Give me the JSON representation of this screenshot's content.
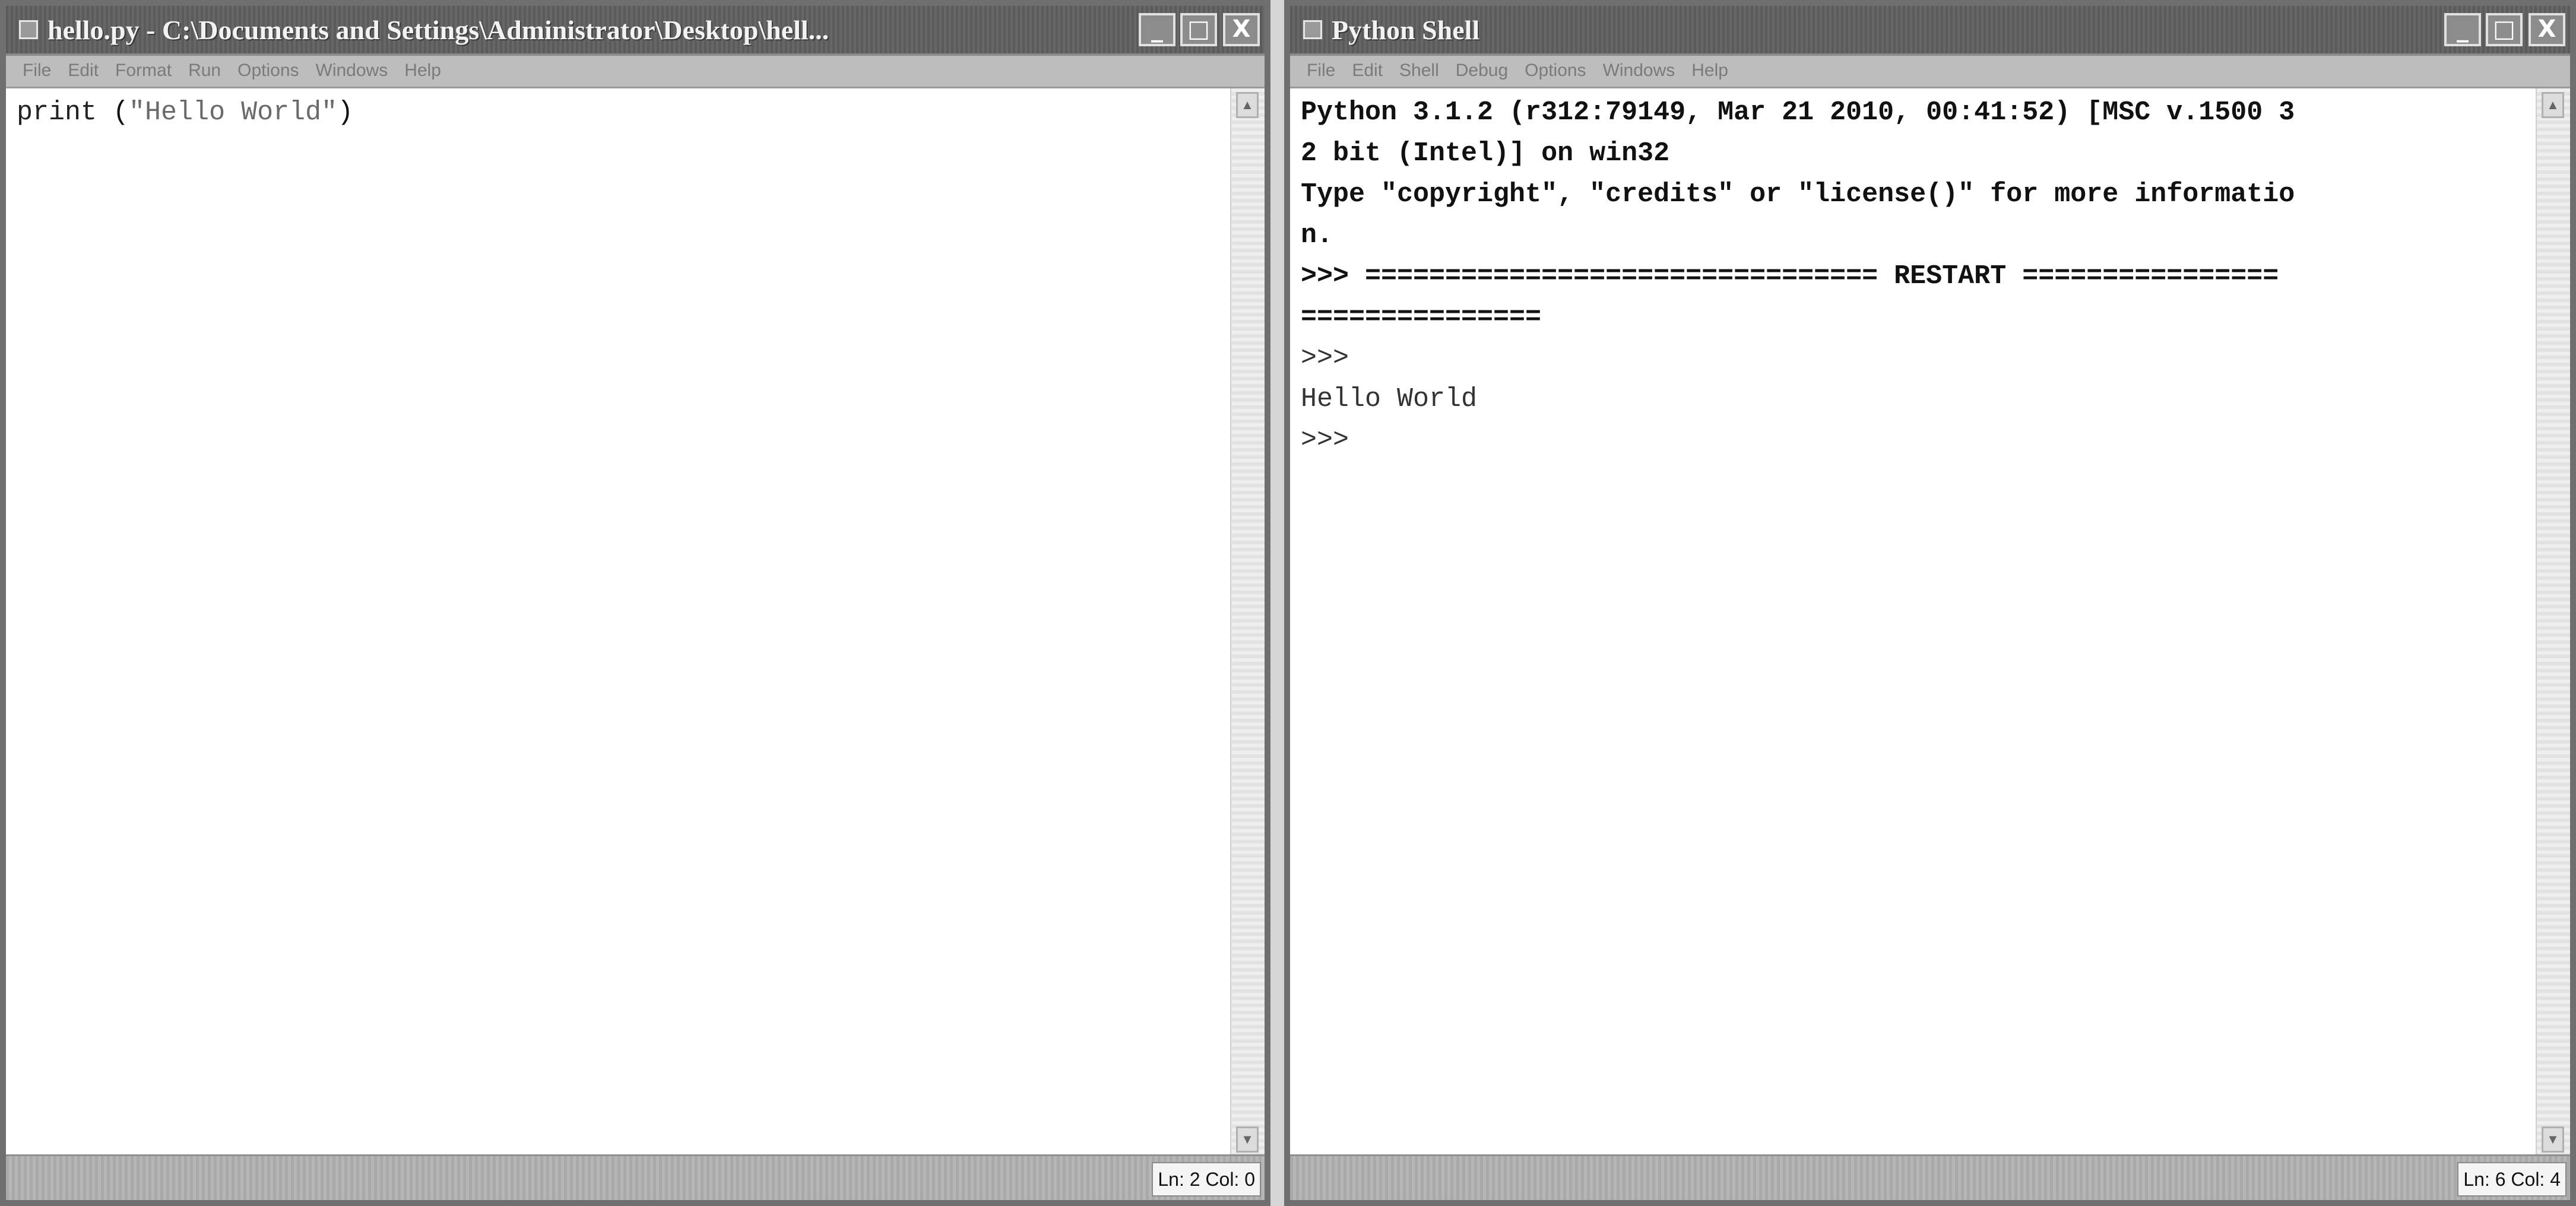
{
  "editor_window": {
    "title": "hello.py - C:\\Documents and Settings\\Administrator\\Desktop\\hell...",
    "menu": [
      "File",
      "Edit",
      "Format",
      "Run",
      "Options",
      "Windows",
      "Help"
    ],
    "code": {
      "func": "print",
      "open": " (",
      "string": "\"Hello World\"",
      "close": ")"
    },
    "status": "Ln: 2 Col: 0",
    "controls": {
      "minimize": "_",
      "maximize": "□",
      "close": "X"
    }
  },
  "shell_window": {
    "title": "Python Shell",
    "menu": [
      "File",
      "Edit",
      "Shell",
      "Debug",
      "Options",
      "Windows",
      "Help"
    ],
    "lines": [
      "Python 3.1.2 (r312:79149, Mar 21 2010, 00:41:52) [MSC v.1500 3",
      "2 bit (Intel)] on win32",
      "Type \"copyright\", \"credits\" or \"license()\" for more informatio",
      "n.",
      ">>> ================================ RESTART ================",
      "===============",
      ">>>",
      "Hello World",
      ">>>"
    ],
    "status": "Ln: 6 Col: 4",
    "controls": {
      "minimize": "_",
      "maximize": "□",
      "close": "X"
    }
  }
}
